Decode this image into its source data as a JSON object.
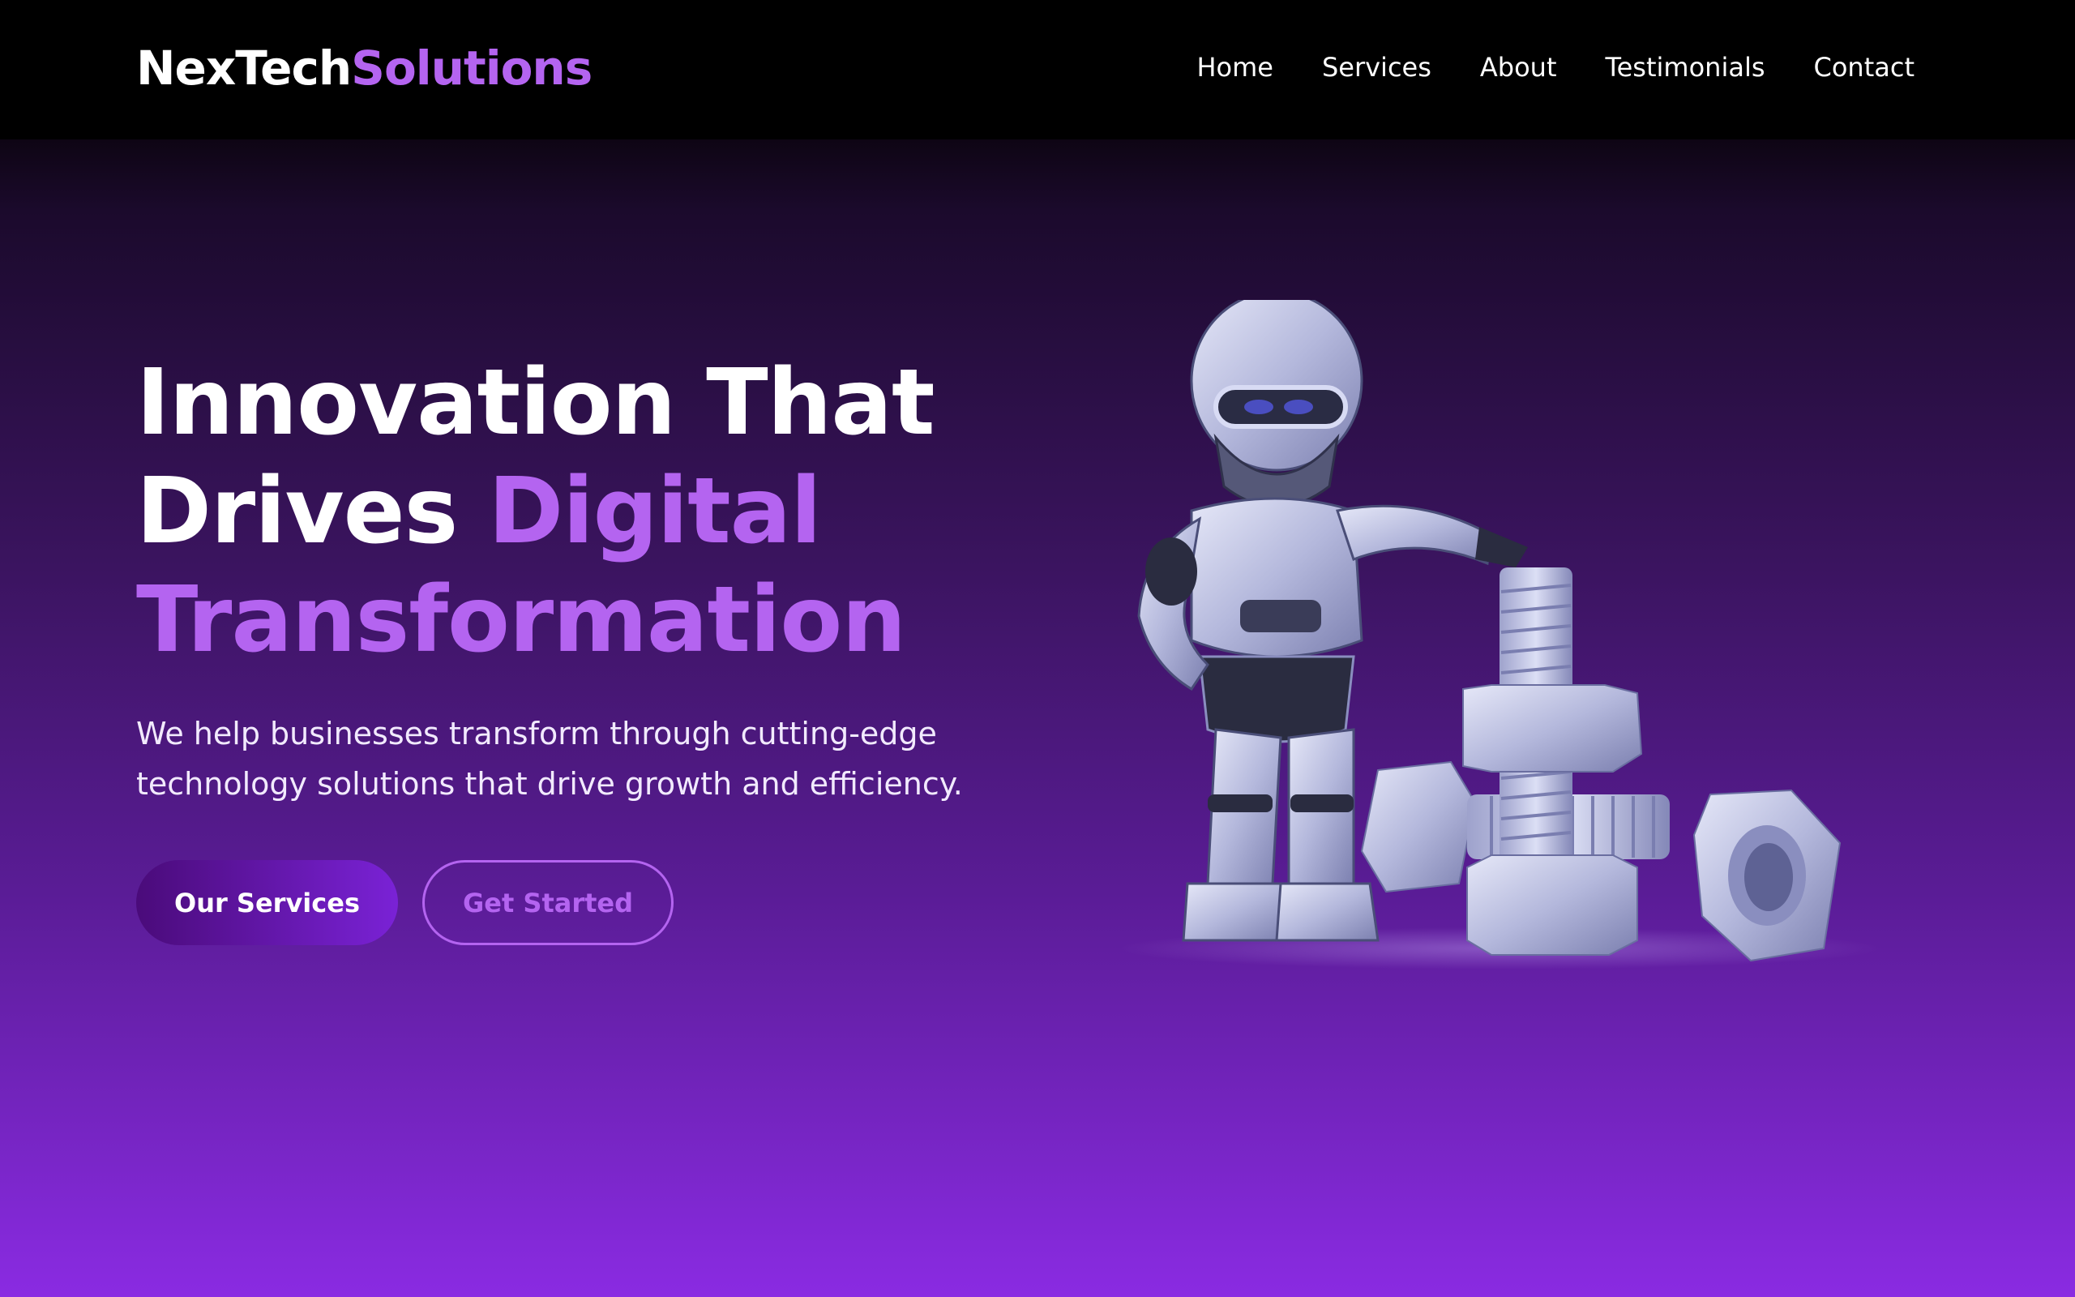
{
  "brand": {
    "part1": "NexTech",
    "part2": "Solutions",
    "accent_color": "#b464f0"
  },
  "nav": {
    "items": [
      {
        "label": "Home"
      },
      {
        "label": "Services"
      },
      {
        "label": "About"
      },
      {
        "label": "Testimonials"
      },
      {
        "label": "Contact"
      }
    ]
  },
  "hero": {
    "title_line1": "Innovation That",
    "title_line2_plain": "Drives ",
    "title_line2_accent": "Digital",
    "title_line3_accent": "Transformation",
    "subtitle": "We help businesses transform through cutting-edge technology solutions that drive growth and efficiency.",
    "primary_button": "Our Services",
    "secondary_button": "Get Started",
    "illustration": "robot-with-bolts-illustration"
  }
}
